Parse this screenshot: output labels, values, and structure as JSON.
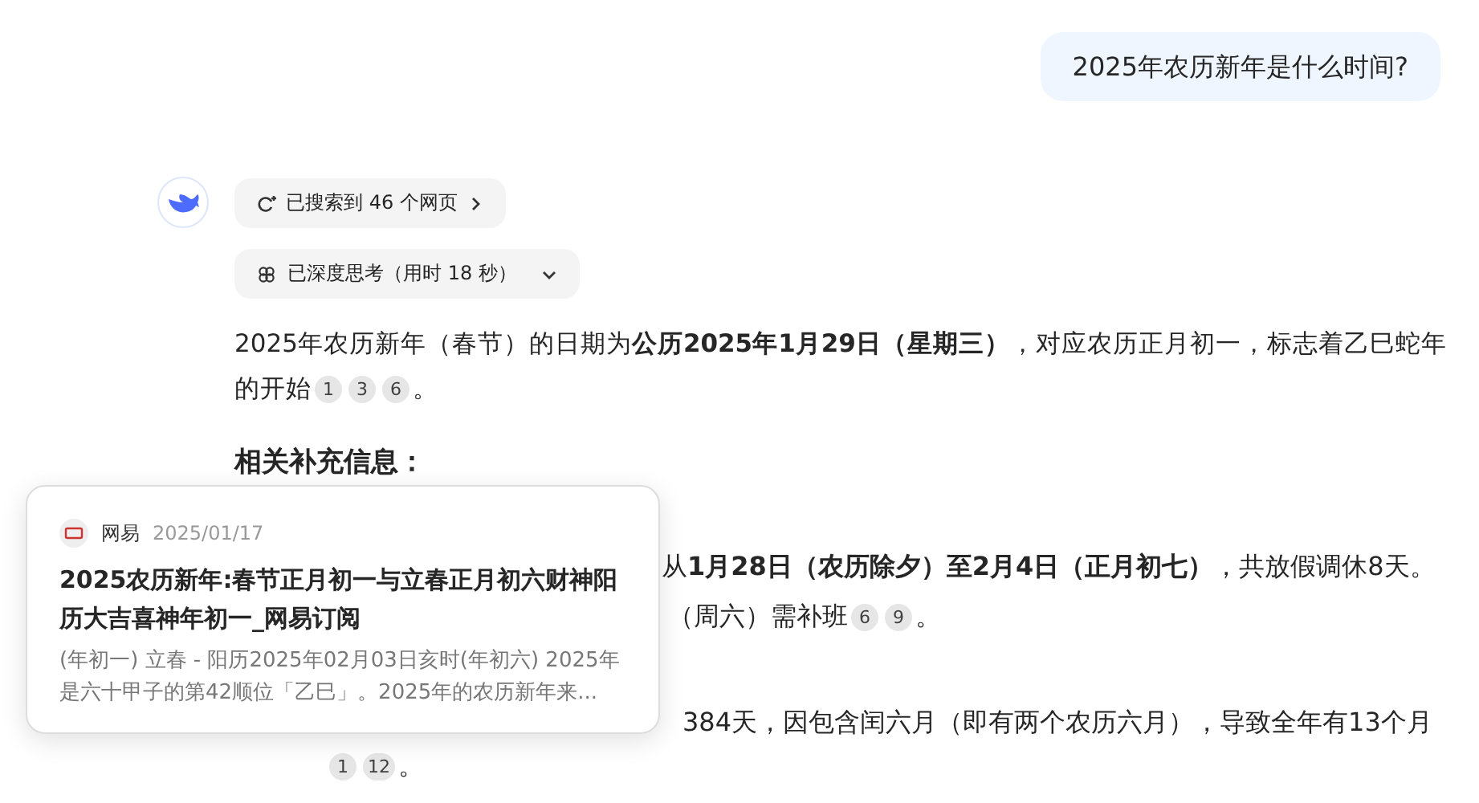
{
  "user_message": "2025年农历新年是什么时间?",
  "search_chip": {
    "label": "已搜索到 46 个网页"
  },
  "thinking_chip": {
    "label": "已深度思考（用时 18 秒）",
    "expanded": false
  },
  "answer": [
    {
      "text": "2025年农历新年（春节）的日期为**公历2025年1月29日（星期三）**，对应农历正月初一，标志着乙巳蛇年"
    },
    {
      "text": "的开始",
      "citations": [
        "1",
        "3",
        "6"
      ],
      "end": "。"
    }
  ],
  "heading": "相关补充信息：",
  "covered_lines": [
    {
      "text": "从**1月28日（农历除夕）至2月4日（正月初七）**，共放假调休8天。"
    },
    {
      "text": "（周六）需补班",
      "citations": [
        "6",
        "9"
      ],
      "end": "。"
    },
    {
      "text": "384天，因包含闰六月（即有两个农历六月），导致全年有13个月"
    },
    {
      "citations": [
        "1",
        "12"
      ],
      "end": "。"
    }
  ],
  "source_popup": {
    "source": "网易",
    "date": "2025/01/17",
    "title": "2025农历新年:春节正月初一与立春正月初六财神阳历大吉喜神年初一_网易订阅",
    "snippet": "(年初一) 立春 - 阳历2025年02月03日亥时(年初六) 2025年是六十甲子的第42顺位「乙巳」。2025年的农历新年来..."
  }
}
